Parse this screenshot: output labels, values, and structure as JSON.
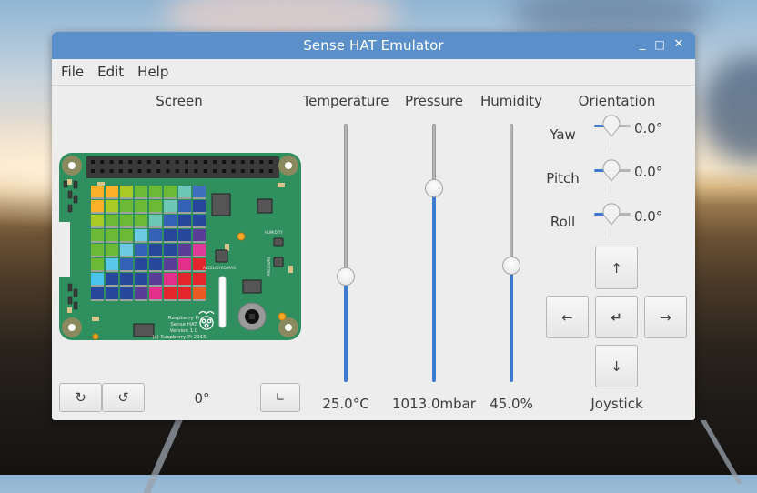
{
  "window": {
    "title": "Sense HAT Emulator",
    "controls": {
      "minimize": "_",
      "maximize": "□",
      "close": "✕"
    }
  },
  "menu": [
    "File",
    "Edit",
    "Help"
  ],
  "screen": {
    "label": "Screen",
    "rotation_value": "0°",
    "buttons": {
      "rotate_cw": "↻",
      "rotate_ccw": "↺",
      "orientation_toggle": "∟"
    },
    "board_text": {
      "accel_label": "ACCEL/GYRO/MAG",
      "humidity_label": "HUMIDITY",
      "pressure_label": "PRESSURE",
      "product_lines": [
        "Raspberry Pi",
        "Sense HAT",
        "Version 1.0",
        "(c) Raspberry Pi 2015"
      ]
    },
    "led_matrix": [
      [
        "#fbb027",
        "#fbb027",
        "#a9c924",
        "#6cb935",
        "#6cb935",
        "#6cb935",
        "#6fc7b8",
        "#3f6fbf"
      ],
      [
        "#fbb027",
        "#a9c924",
        "#6cb935",
        "#6cb935",
        "#6cb935",
        "#6fc7b8",
        "#3561b6",
        "#27479c"
      ],
      [
        "#a9c924",
        "#6cb935",
        "#6cb935",
        "#6cb935",
        "#6fc7b8",
        "#3561b6",
        "#27479c",
        "#27479c"
      ],
      [
        "#6cb935",
        "#6cb935",
        "#6cb935",
        "#6ccbe3",
        "#3561b6",
        "#27479c",
        "#27479c",
        "#5a3d99"
      ],
      [
        "#6cb935",
        "#6cb935",
        "#6ccbe3",
        "#3561b6",
        "#27479c",
        "#27479c",
        "#5a3d99",
        "#de3a97"
      ],
      [
        "#6cb935",
        "#5ac8eb",
        "#3561b6",
        "#27479c",
        "#27479c",
        "#5a3d99",
        "#e32e8c",
        "#e4262c"
      ],
      [
        "#4cc3ee",
        "#27479c",
        "#27479c",
        "#27479c",
        "#5a3d99",
        "#e32e8c",
        "#e4262c",
        "#e4262c"
      ],
      [
        "#27479c",
        "#27479c",
        "#27479c",
        "#5a3d99",
        "#e32e8c",
        "#e4262c",
        "#e4262c",
        "#ec5a24"
      ]
    ]
  },
  "sensors": [
    {
      "label": "Temperature",
      "value_text": "25.0°C",
      "fraction": 0.41
    },
    {
      "label": "Pressure",
      "value_text": "1013.0mbar",
      "fraction": 0.75
    },
    {
      "label": "Humidity",
      "value_text": "45.0%",
      "fraction": 0.45
    }
  ],
  "orientation": {
    "label": "Orientation",
    "axes": [
      {
        "label": "Yaw",
        "value_text": "0.0°"
      },
      {
        "label": "Pitch",
        "value_text": "0.0°"
      },
      {
        "label": "Roll",
        "value_text": "0.0°"
      }
    ]
  },
  "joystick": {
    "label": "Joystick",
    "up": "↑",
    "left": "←",
    "enter": "↵",
    "right": "→",
    "down": "↓"
  },
  "colors": {
    "titlebar": "#5b8fc9",
    "accent": "#3d7bd0",
    "board": "#2f8f5f",
    "window_bg": "#ededed"
  }
}
